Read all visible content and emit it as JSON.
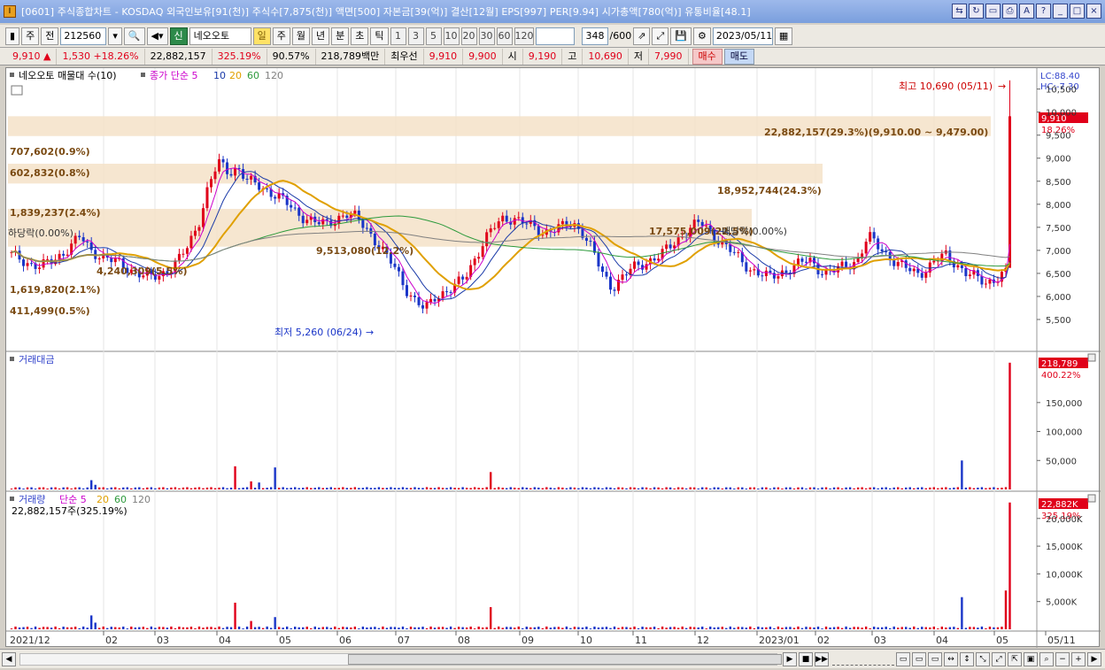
{
  "window": {
    "title": "[0601] 주식종합차트 - KOSDAQ 외국인보유[91(천)] 주식수[7,875(천)] 액면[500] 자본금[39(억)] 결산[12월] EPS[997] PER[9.94] 시가총액[780(억)] 유통비율[48.1]"
  },
  "toolbar": {
    "mode": "주",
    "scope": "전",
    "code": "212560",
    "stock_name": "네오오토",
    "periods": [
      "일",
      "주",
      "월",
      "년",
      "분",
      "초",
      "틱"
    ],
    "selected_period": "일",
    "intervals": [
      "1",
      "3",
      "5",
      "10",
      "20",
      "30",
      "60",
      "120"
    ],
    "count": "348",
    "count_total": "/600",
    "date": "2023/05/11",
    "sin_label": "신"
  },
  "quote": {
    "price": "9,910",
    "change": "1,530",
    "change_pct": "+18.26%",
    "volume": "22,882,157",
    "vol_ratio": "325.19%",
    "ratio2": "90.57%",
    "amount": "218,789백만",
    "best_label": "최우선",
    "bid": "9,910",
    "ask": "9,900",
    "open_label": "시",
    "open": "9,190",
    "high_label": "고",
    "high": "10,690",
    "low_label": "저",
    "low": "7,990",
    "buy": "매수",
    "sell": "매도"
  },
  "price_panel": {
    "legend_name": "네오오토 매물대 수(10)",
    "ma_label": "종가 단순 5",
    "ma_periods": [
      "10",
      "20",
      "60",
      "120"
    ],
    "lc": "LC:88.40",
    "hc": "HC:-7.30",
    "current_price": "9,910",
    "current_pct": "18.26%",
    "high_note": "최고 10,690 (05/11)",
    "low_note": "최저 5,260 (06/24)",
    "left_labels": [
      "707,602(0.9%)",
      "602,832(0.8%)",
      "1,839,237(2.4%)",
      "하당락(0.00%)",
      "4,240,309(5.5%)",
      "1,619,820(2.1%)",
      "411,499(0.5%)"
    ],
    "mid_labels": [
      "9,513,080(12.2%)",
      "17,575,009(22.5%)",
      "배당락(0.00%)"
    ],
    "bar_labels": [
      "22,882,157(29.3%)(9,910.00 ~ 9,479.00)",
      "18,952,744(24.3%)"
    ],
    "y_ticks": [
      "10,500",
      "10,000",
      "9,500",
      "9,000",
      "8,500",
      "8,000",
      "7,500",
      "7,000",
      "6,500",
      "6,000",
      "5,500"
    ]
  },
  "amount_panel": {
    "title": "거래대금",
    "current": "218,789",
    "pct": "400.22%",
    "y_ticks": [
      "150,000",
      "100,000",
      "50,000"
    ]
  },
  "volume_panel": {
    "title": "거래량",
    "ma_label": "단순 5",
    "ma_periods": [
      "20",
      "60",
      "120"
    ],
    "subtitle": "22,882,157주(325.19%)",
    "current": "22,882K",
    "pct": "325.19%",
    "y_ticks": [
      "20,000K",
      "15,000K",
      "10,000K",
      "5,000K"
    ]
  },
  "x_axis": [
    "2021/12",
    "02",
    "03",
    "04",
    "05",
    "06",
    "07",
    "08",
    "09",
    "10",
    "11",
    "12",
    "2023/01",
    "02",
    "03",
    "04",
    "05",
    "05/11"
  ],
  "colors": {
    "up": "#e0001a",
    "down": "#1a35c8",
    "ma5": "#cc00cc",
    "ma10": "#1a3aa8",
    "ma20": "#e0a000",
    "ma60": "#2d9a3c",
    "ma120": "#808080",
    "band": "#f5e2c8"
  },
  "chart_data": {
    "type": "candlestick",
    "y_range": [
      5260,
      10690
    ],
    "close_path": [
      6900,
      6800,
      6700,
      6650,
      6750,
      6900,
      7100,
      7300,
      7000,
      6900,
      6800,
      6700,
      6600,
      6500,
      6400,
      6450,
      6600,
      6800,
      7100,
      7600,
      8400,
      8900,
      8700,
      8800,
      8500,
      8400,
      8300,
      8200,
      8000,
      7800,
      7700,
      7600,
      7550,
      7700,
      7800,
      7700,
      7500,
      7200,
      6900,
      6600,
      6200,
      5900,
      5700,
      6000,
      6100,
      6200,
      6400,
      6800,
      7200,
      7500,
      7700,
      7700,
      7600,
      7500,
      7400,
      7450,
      7500,
      7600,
      7400,
      7000,
      6500,
      6200,
      6400,
      6600,
      6700,
      6800,
      6900,
      7100,
      7300,
      7500,
      7600,
      7400,
      7200,
      7000,
      6800,
      6600,
      6500,
      6400,
      6500,
      6600,
      6700,
      6800,
      6600,
      6500,
      6600,
      6700,
      6800,
      7300,
      7100,
      6900,
      6700,
      6600,
      6500,
      6600,
      6800,
      6900,
      6700,
      6500,
      6400,
      6300,
      6400,
      6500,
      9910
    ]
  }
}
